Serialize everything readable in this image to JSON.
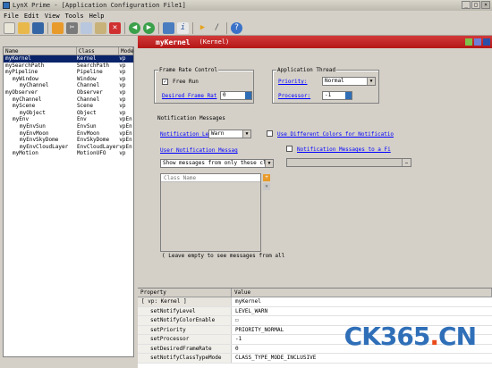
{
  "window": {
    "title": "LynX Prime - [Application Configuration File1]",
    "buttons": [
      "_",
      "□",
      "×"
    ]
  },
  "menu": [
    "File",
    "Edit",
    "View",
    "Tools",
    "Help"
  ],
  "toolbar_icons": [
    "new-file-icon",
    "open-folder-icon",
    "save-icon",
    "save-all-icon",
    "cut-icon",
    "copy-icon",
    "paste-icon",
    "delete-icon",
    "back-icon",
    "forward-icon",
    "properties-icon",
    "info-icon",
    "run-icon",
    "edit-icon",
    "help-icon"
  ],
  "tree": {
    "headers": [
      "Name",
      "Class",
      "Mode"
    ],
    "rows": [
      {
        "name": "myKernel",
        "class": "Kernel",
        "mode": "vp",
        "indent": 0,
        "selected": true
      },
      {
        "name": "mySearchPath",
        "class": "SearchPath",
        "mode": "vp",
        "indent": 0
      },
      {
        "name": "myPipeline",
        "class": "Pipeline",
        "mode": "vp",
        "indent": 0
      },
      {
        "name": "myWindow",
        "class": "Window",
        "mode": "vp",
        "indent": 1
      },
      {
        "name": "myChannel",
        "class": "Channel",
        "mode": "vp",
        "indent": 2
      },
      {
        "name": "myObserver",
        "class": "Observer",
        "mode": "vp",
        "indent": 0
      },
      {
        "name": "myChannel",
        "class": "Channel",
        "mode": "vp",
        "indent": 1
      },
      {
        "name": "myScene",
        "class": "Scene",
        "mode": "vp",
        "indent": 1
      },
      {
        "name": "myObject",
        "class": "Object",
        "mode": "vp",
        "indent": 2
      },
      {
        "name": "myEnv",
        "class": "Env",
        "mode": "vpEn",
        "indent": 1
      },
      {
        "name": "myEnvSun",
        "class": "EnvSun",
        "mode": "vpEn",
        "indent": 2
      },
      {
        "name": "myEnvMoon",
        "class": "EnvMoon",
        "mode": "vpEn",
        "indent": 2
      },
      {
        "name": "myEnvSkyDome",
        "class": "EnvSkyDome",
        "mode": "vpEn",
        "indent": 2
      },
      {
        "name": "myEnvCloudLayer",
        "class": "EnvCloudLayer",
        "mode": "vpEn",
        "indent": 2
      },
      {
        "name": "myMotion",
        "class": "MotionUFO",
        "mode": "vp",
        "indent": 1
      }
    ]
  },
  "header": {
    "name": "myKernel",
    "type": "(Kernel)"
  },
  "frame_rate": {
    "title": "Frame Rate Control",
    "free_run_label": "Free Run",
    "free_run_checked": true,
    "desired_label": "Desired Frame Rat",
    "desired_value": "0"
  },
  "app_thread": {
    "title": "Application Thread",
    "priority_label": "Priority:",
    "priority_value": "Normal",
    "processor_label": "Processor:",
    "processor_value": "-1"
  },
  "notifications": {
    "title": "Notification Messages",
    "level_label": "Notification Leve",
    "level_value": "Warn",
    "diff_colors_label": "Use Different Colors for Notificatio",
    "user_label": "User Notification Messag",
    "to_file_label": "Notification Messages to a Fi",
    "filter_value": "Show messages from only these clas",
    "class_list_header": "Class Name",
    "hint": "( Leave empty to see messages from all"
  },
  "property_grid": {
    "headers": [
      "Property",
      "Value"
    ],
    "rows": [
      {
        "name": "[ vp: Kernel ]",
        "value": "myKernel",
        "group": true
      },
      {
        "name": "setNotifyLevel",
        "value": "LEVEL_WARN"
      },
      {
        "name": "setNotifyColorEnable",
        "value": "☐"
      },
      {
        "name": "setPriority",
        "value": "PRIORITY_NORMAL"
      },
      {
        "name": "setProcessor",
        "value": "-1"
      },
      {
        "name": "setDesiredFrameRate",
        "value": "0"
      },
      {
        "name": "setNotifyClassTypeMode",
        "value": "CLASS_TYPE_MODE_INCLUSIVE"
      }
    ]
  },
  "watermark": {
    "part1": "CK365",
    "dot": ".",
    "part2": "CN"
  }
}
